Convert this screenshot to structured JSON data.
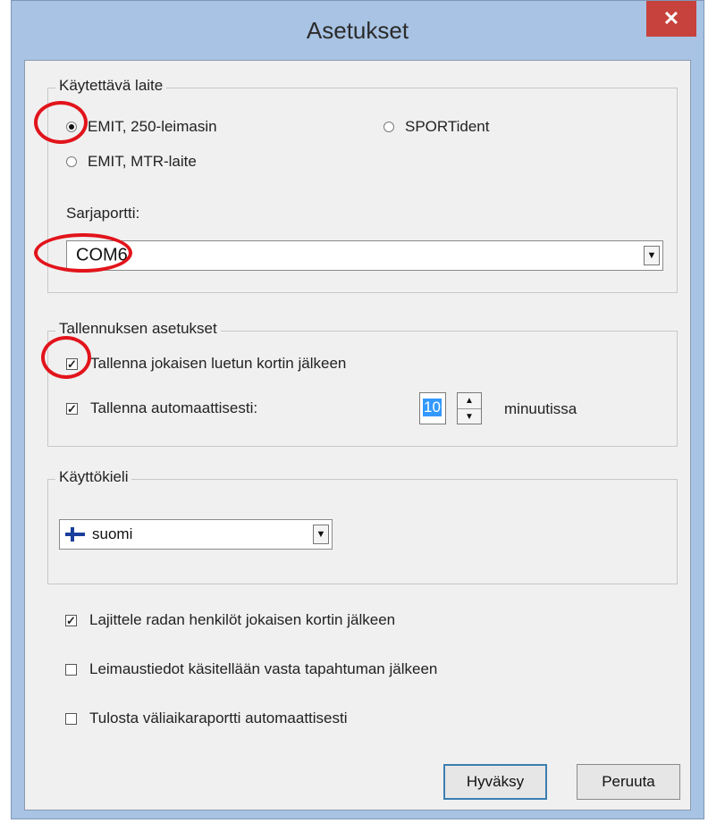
{
  "window": {
    "title": "Asetukset",
    "close_glyph": "✕"
  },
  "device_group": {
    "title": "Käytettävä laite",
    "options": [
      {
        "label": "EMIT, 250-leimasin",
        "selected": true
      },
      {
        "label": "SPORTident",
        "selected": false
      },
      {
        "label": "EMIT, MTR-laite",
        "selected": false
      }
    ],
    "port_label": "Sarjaportti:",
    "port_value": "COM6"
  },
  "save_group": {
    "title": "Tallennuksen asetukset",
    "save_after_card": {
      "label": "Tallenna jokaisen luetun kortin jälkeen",
      "checked": true
    },
    "autosave": {
      "label": "Tallenna automaattisesti:",
      "checked": true
    },
    "interval_value": "10",
    "interval_unit": "minuutissa"
  },
  "language_group": {
    "title": "Käyttökieli",
    "selected": "suomi",
    "flag_icon": "finland-flag-icon"
  },
  "options": [
    {
      "label": "Lajittele radan henkilöt jokaisen kortin jälkeen",
      "checked": true
    },
    {
      "label": "Leimaustiedot käsitellään vasta tapahtuman jälkeen",
      "checked": false
    },
    {
      "label": "Tulosta väliaikaraportti automaattisesti",
      "checked": false
    }
  ],
  "buttons": {
    "ok": "Hyväksy",
    "cancel": "Peruuta"
  },
  "colors": {
    "highlight_circle": "#e2141b",
    "title_bar": "#a8c3e3",
    "close_button": "#c7423c"
  }
}
